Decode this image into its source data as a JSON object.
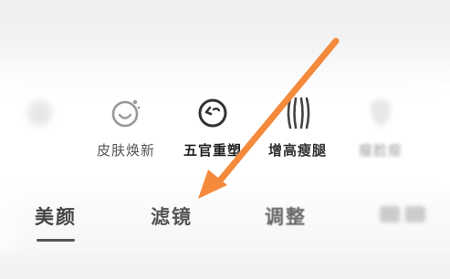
{
  "tools": [
    {
      "name": "faint-icon",
      "label": ""
    },
    {
      "name": "skin-refresh-icon",
      "label": "皮肤焕新"
    },
    {
      "name": "face-features-icon",
      "label": "五官重塑"
    },
    {
      "name": "height-legs-icon",
      "label": "增高瘦腿"
    },
    {
      "name": "slim-icon",
      "label": "瘦脸瘦"
    }
  ],
  "tabs": [
    {
      "label": "美颜",
      "active": true
    },
    {
      "label": "滤镜",
      "active": false
    },
    {
      "label": "调整",
      "active": false
    },
    {
      "label": "",
      "active": false
    }
  ],
  "annotation": {
    "arrow_color": "#f48a3c",
    "arrow_target": "滤镜"
  }
}
